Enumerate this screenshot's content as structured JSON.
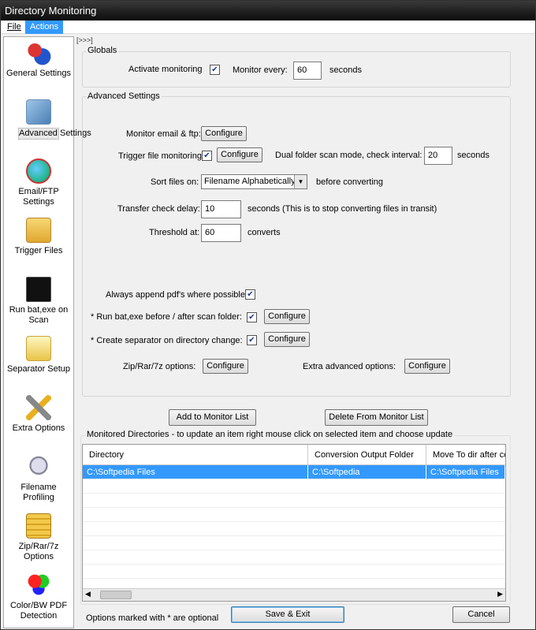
{
  "window": {
    "title": "Directory Monitoring"
  },
  "menu": {
    "file": "File",
    "actions": "Actions"
  },
  "sidebar": {
    "toggle": "[>>>]",
    "items": [
      {
        "label": "General Settings",
        "icon": "gears-icon"
      },
      {
        "label": "Advanced Settings",
        "icon": "advanced-icon"
      },
      {
        "label": "Email/FTP Settings",
        "icon": "globe-icon"
      },
      {
        "label": "Trigger Files",
        "icon": "folder-icon"
      },
      {
        "label": "Run bat,exe on Scan",
        "icon": "terminal-icon"
      },
      {
        "label": "Separator Setup",
        "icon": "separator-icon"
      },
      {
        "label": "Extra Options",
        "icon": "tools-icon"
      },
      {
        "label": "Filename Profiling",
        "icon": "profile-icon"
      },
      {
        "label": "Zip/Rar/7z Options",
        "icon": "archive-icon"
      },
      {
        "label": "Color/BW PDF Detection",
        "icon": "color-icon"
      }
    ]
  },
  "globals": {
    "title": "Globals",
    "activate_label": "Activate monitoring",
    "activate_checked": true,
    "monitor_every_label": "Monitor every:",
    "monitor_every_value": "60",
    "seconds": "seconds"
  },
  "advanced": {
    "title": "Advanced Settings",
    "email_label": "Monitor email & ftp:",
    "configure": "Configure",
    "trigger_label": "Trigger file monitoring:",
    "trigger_checked": true,
    "dual_label": "Dual folder scan mode, check interval:",
    "dual_value": "20",
    "seconds": "seconds",
    "sort_label": "Sort files on:",
    "sort_value": "Filename Alphabetically",
    "sort_suffix": "before converting",
    "transfer_label": "Transfer check delay:",
    "transfer_value": "10",
    "transfer_suffix": "seconds  (This is to stop converting files in transit)",
    "threshold_label": "Threshold at:",
    "threshold_value": "60",
    "threshold_suffix": "converts",
    "append_label": "Always append pdf's where possible",
    "append_checked": true,
    "runbat_label": "*   Run bat,exe before / after scan folder:",
    "runbat_checked": true,
    "separator_label": "*   Create separator on directory change:",
    "separator_checked": true,
    "zip_label": "Zip/Rar/7z options:",
    "extra_label": "Extra advanced options:"
  },
  "buttons": {
    "add": "Add to Monitor List",
    "delete": "Delete From Monitor List",
    "save": "Save & Exit",
    "cancel": "Cancel"
  },
  "monitored": {
    "title": "Monitored Directories   -   to update an item right mouse click on selected item and choose update",
    "columns": [
      "Directory",
      "Conversion Output Folder",
      "Move To dir after co"
    ],
    "rows": [
      [
        "C:\\Softpedia Files",
        "C:\\Softpedia",
        "C:\\Softpedia Files"
      ]
    ]
  },
  "footer": {
    "note": "Options marked with * are optional"
  }
}
